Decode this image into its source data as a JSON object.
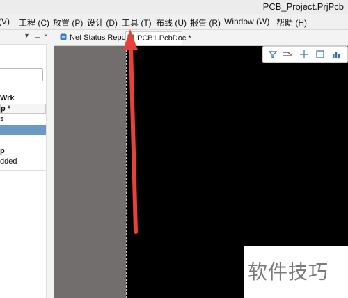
{
  "window": {
    "title": "PCB_Project.PrjPcb"
  },
  "menu": {
    "items": [
      "(V)",
      "工程 (C)",
      "放置 (P)",
      "设计 (D)",
      "工具 (T)",
      "布线 (U)",
      "报告 (R)",
      "Window (W)",
      "帮助 (H)"
    ]
  },
  "panel": {
    "controls": {
      "dropdown": "▾",
      "pin": "⊥",
      "close": "×"
    },
    "rows": [
      "Wrk",
      "p *",
      "s",
      "",
      "p",
      "dded"
    ]
  },
  "tabs": {
    "items": [
      {
        "label": "Net Status Report",
        "active": false
      },
      {
        "label": "PCB1.PcbDoc *",
        "active": true
      }
    ]
  },
  "editor_toolbar": {
    "icons": [
      "filter-icon",
      "route-icon",
      "crosshair-icon",
      "rectangle-select-icon",
      "chart-icon"
    ]
  },
  "watermark": {
    "text": "软件技巧"
  },
  "colors": {
    "accent_selection": "#6b99c6",
    "arrow": "#e8403a",
    "canvas": "#000000",
    "gray_region": "#716e6d"
  }
}
